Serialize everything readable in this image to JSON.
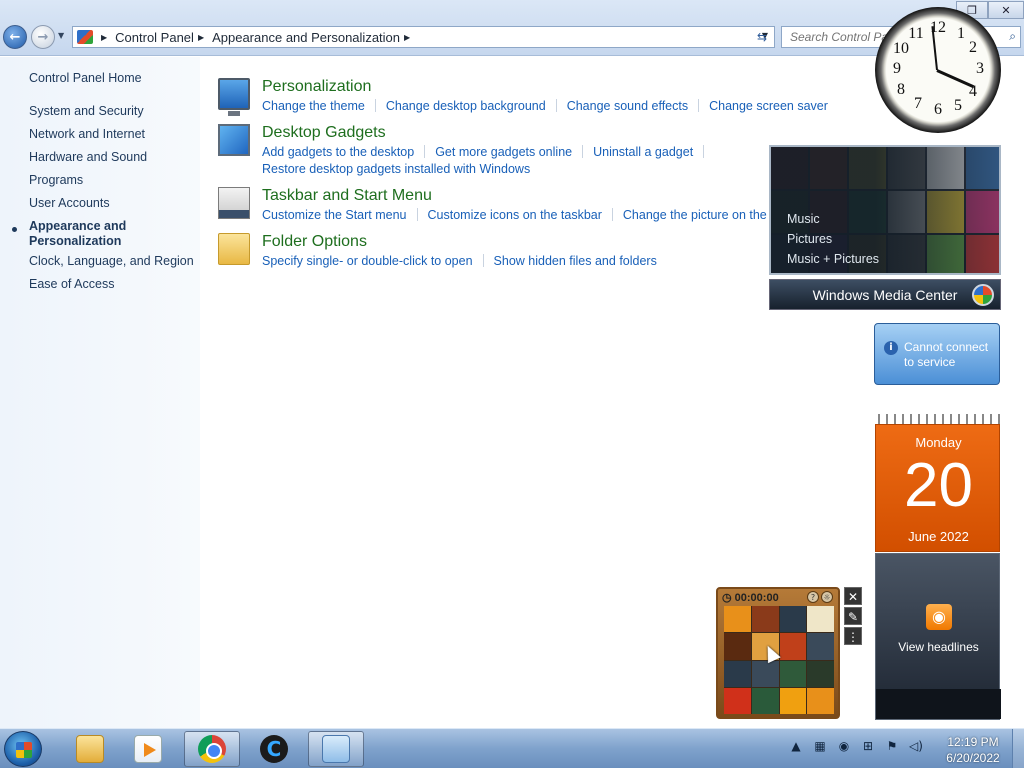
{
  "address_bar": {
    "breadcrumbs": [
      "Control Panel",
      "Appearance and Personalization"
    ],
    "search_placeholder": "Search Control Pa"
  },
  "left_nav": {
    "home": "Control Panel Home",
    "items": [
      "System and Security",
      "Network and Internet",
      "Hardware and Sound",
      "Programs",
      "User Accounts"
    ],
    "active": "Appearance and Personalization",
    "active_line1": "Appearance and",
    "active_line2": "Personalization",
    "items_after": [
      "Clock, Language, and Region",
      "Ease of Access"
    ]
  },
  "categories": [
    {
      "title": "Personalization",
      "icon": "monitor-icon",
      "links": [
        "Change the theme",
        "Change desktop background",
        "Change sound effects",
        "Change screen saver"
      ]
    },
    {
      "title": "Desktop Gadgets",
      "icon": "gadgets-icon",
      "links": [
        "Add gadgets to the desktop",
        "Get more gadgets online",
        "Uninstall a gadget"
      ],
      "links_line2": [
        "Restore desktop gadgets installed with Windows"
      ]
    },
    {
      "title": "Taskbar and Start Menu",
      "icon": "taskbar-icon",
      "links": [
        "Customize the Start menu",
        "Customize icons on the taskbar",
        "Change the picture on the Star"
      ]
    },
    {
      "title": "Folder Options",
      "icon": "folder-icon",
      "links": [
        "Specify single- or double-click to open",
        "Show hidden files and folders"
      ]
    }
  ],
  "gadgets": {
    "clock": {
      "numerals": [
        "12",
        "1",
        "2",
        "3",
        "4",
        "5",
        "6",
        "7",
        "8",
        "9",
        "10",
        "11"
      ],
      "time": "12:19"
    },
    "media_center": {
      "menu": [
        "Music",
        "Pictures",
        "Music + Pictures"
      ],
      "brand_windows": "Windows",
      "brand_mc": "Media Center"
    },
    "weather": {
      "message_line1": "Cannot connect",
      "message_line2": "to service"
    },
    "calendar": {
      "weekday": "Monday",
      "day": "20",
      "month_year": "June 2022"
    },
    "feed": {
      "label": "View headlines"
    },
    "puzzle": {
      "timer": "00:00:00"
    }
  },
  "taskbar": {
    "time": "12:19 PM",
    "date": "6/20/2022",
    "apps": [
      "explorer-icon",
      "media-player-icon",
      "chrome-icon",
      "ccleaner-icon",
      "control-panel-icon"
    ]
  },
  "colors": {
    "link": "#1960b8",
    "category_title": "#1e6e1e",
    "calendar_orange": "#e55f0a"
  }
}
